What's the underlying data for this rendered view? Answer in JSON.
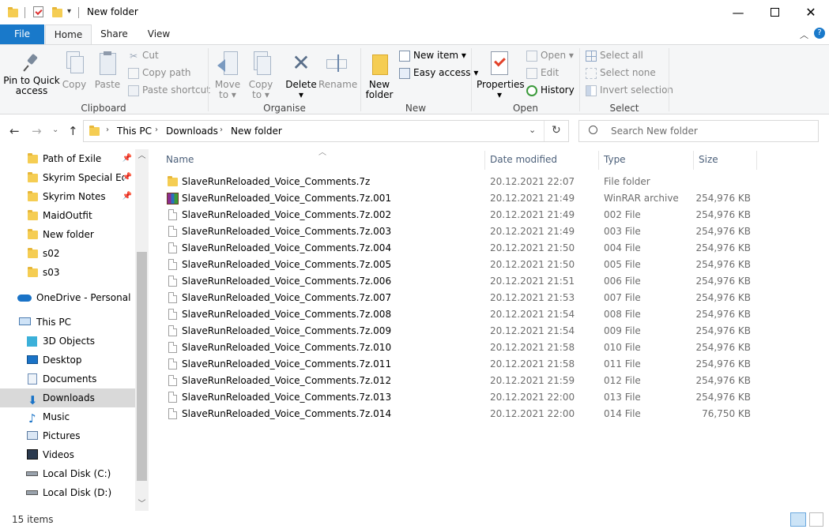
{
  "title": "New folder",
  "tabs": {
    "file": "File",
    "home": "Home",
    "share": "Share",
    "view": "View"
  },
  "ribbon": {
    "clipboard": {
      "label": "Clipboard",
      "pin": "Pin to Quick access",
      "pin_l1": "Pin to Quick",
      "pin_l2": "access",
      "copy": "Copy",
      "paste": "Paste",
      "cut": "Cut",
      "copy_path": "Copy path",
      "paste_shortcut": "Paste shortcut"
    },
    "organise": {
      "label": "Organise",
      "move_l1": "Move",
      "move_l2": "to",
      "copy_l1": "Copy",
      "copy_l2": "to",
      "delete": "Delete",
      "rename": "Rename"
    },
    "new": {
      "label": "New",
      "folder_l1": "New",
      "folder_l2": "folder",
      "new_item": "New item",
      "easy_access": "Easy access"
    },
    "open": {
      "label": "Open",
      "properties": "Properties",
      "open": "Open",
      "edit": "Edit",
      "history": "History"
    },
    "select": {
      "label": "Select",
      "select_all": "Select all",
      "select_none": "Select none",
      "invert": "Invert selection"
    }
  },
  "address": {
    "crumbs": [
      "This PC",
      "Downloads",
      "New folder"
    ]
  },
  "search": {
    "placeholder": "Search New folder"
  },
  "nav": {
    "quick": [
      {
        "label": "Path of Exile",
        "pinned": true
      },
      {
        "label": "Skyrim Special Editi",
        "pinned": true
      },
      {
        "label": "Skyrim Notes",
        "pinned": true
      },
      {
        "label": "MaidOutfit",
        "pinned": false
      },
      {
        "label": "New folder",
        "pinned": false
      },
      {
        "label": "s02",
        "pinned": false
      },
      {
        "label": "s03",
        "pinned": false
      }
    ],
    "onedrive": "OneDrive - Personal",
    "thispc": "This PC",
    "pc_items": [
      "3D Objects",
      "Desktop",
      "Documents",
      "Downloads",
      "Music",
      "Pictures",
      "Videos",
      "Local Disk (C:)",
      "Local Disk (D:)"
    ],
    "selected": "Downloads"
  },
  "columns": {
    "name": "Name",
    "date": "Date modified",
    "type": "Type",
    "size": "Size"
  },
  "files": [
    {
      "name": "SlaveRunReloaded_Voice_Comments.7z",
      "date": "20.12.2021 22:07",
      "type": "File folder",
      "size": "",
      "icon": "folder"
    },
    {
      "name": "SlaveRunReloaded_Voice_Comments.7z.001",
      "date": "20.12.2021 21:49",
      "type": "WinRAR archive",
      "size": "254,976 KB",
      "icon": "rar"
    },
    {
      "name": "SlaveRunReloaded_Voice_Comments.7z.002",
      "date": "20.12.2021 21:49",
      "type": "002 File",
      "size": "254,976 KB",
      "icon": "file"
    },
    {
      "name": "SlaveRunReloaded_Voice_Comments.7z.003",
      "date": "20.12.2021 21:49",
      "type": "003 File",
      "size": "254,976 KB",
      "icon": "file"
    },
    {
      "name": "SlaveRunReloaded_Voice_Comments.7z.004",
      "date": "20.12.2021 21:50",
      "type": "004 File",
      "size": "254,976 KB",
      "icon": "file"
    },
    {
      "name": "SlaveRunReloaded_Voice_Comments.7z.005",
      "date": "20.12.2021 21:50",
      "type": "005 File",
      "size": "254,976 KB",
      "icon": "file"
    },
    {
      "name": "SlaveRunReloaded_Voice_Comments.7z.006",
      "date": "20.12.2021 21:51",
      "type": "006 File",
      "size": "254,976 KB",
      "icon": "file"
    },
    {
      "name": "SlaveRunReloaded_Voice_Comments.7z.007",
      "date": "20.12.2021 21:53",
      "type": "007 File",
      "size": "254,976 KB",
      "icon": "file"
    },
    {
      "name": "SlaveRunReloaded_Voice_Comments.7z.008",
      "date": "20.12.2021 21:54",
      "type": "008 File",
      "size": "254,976 KB",
      "icon": "file"
    },
    {
      "name": "SlaveRunReloaded_Voice_Comments.7z.009",
      "date": "20.12.2021 21:54",
      "type": "009 File",
      "size": "254,976 KB",
      "icon": "file"
    },
    {
      "name": "SlaveRunReloaded_Voice_Comments.7z.010",
      "date": "20.12.2021 21:58",
      "type": "010 File",
      "size": "254,976 KB",
      "icon": "file"
    },
    {
      "name": "SlaveRunReloaded_Voice_Comments.7z.011",
      "date": "20.12.2021 21:58",
      "type": "011 File",
      "size": "254,976 KB",
      "icon": "file"
    },
    {
      "name": "SlaveRunReloaded_Voice_Comments.7z.012",
      "date": "20.12.2021 21:59",
      "type": "012 File",
      "size": "254,976 KB",
      "icon": "file"
    },
    {
      "name": "SlaveRunReloaded_Voice_Comments.7z.013",
      "date": "20.12.2021 22:00",
      "type": "013 File",
      "size": "254,976 KB",
      "icon": "file"
    },
    {
      "name": "SlaveRunReloaded_Voice_Comments.7z.014",
      "date": "20.12.2021 22:00",
      "type": "014 File",
      "size": "76,750 KB",
      "icon": "file"
    }
  ],
  "status": {
    "count": "15 items"
  },
  "colors": {
    "accent": "#1979ca",
    "folder": "#f5cd53",
    "header_text": "#4c607a"
  }
}
